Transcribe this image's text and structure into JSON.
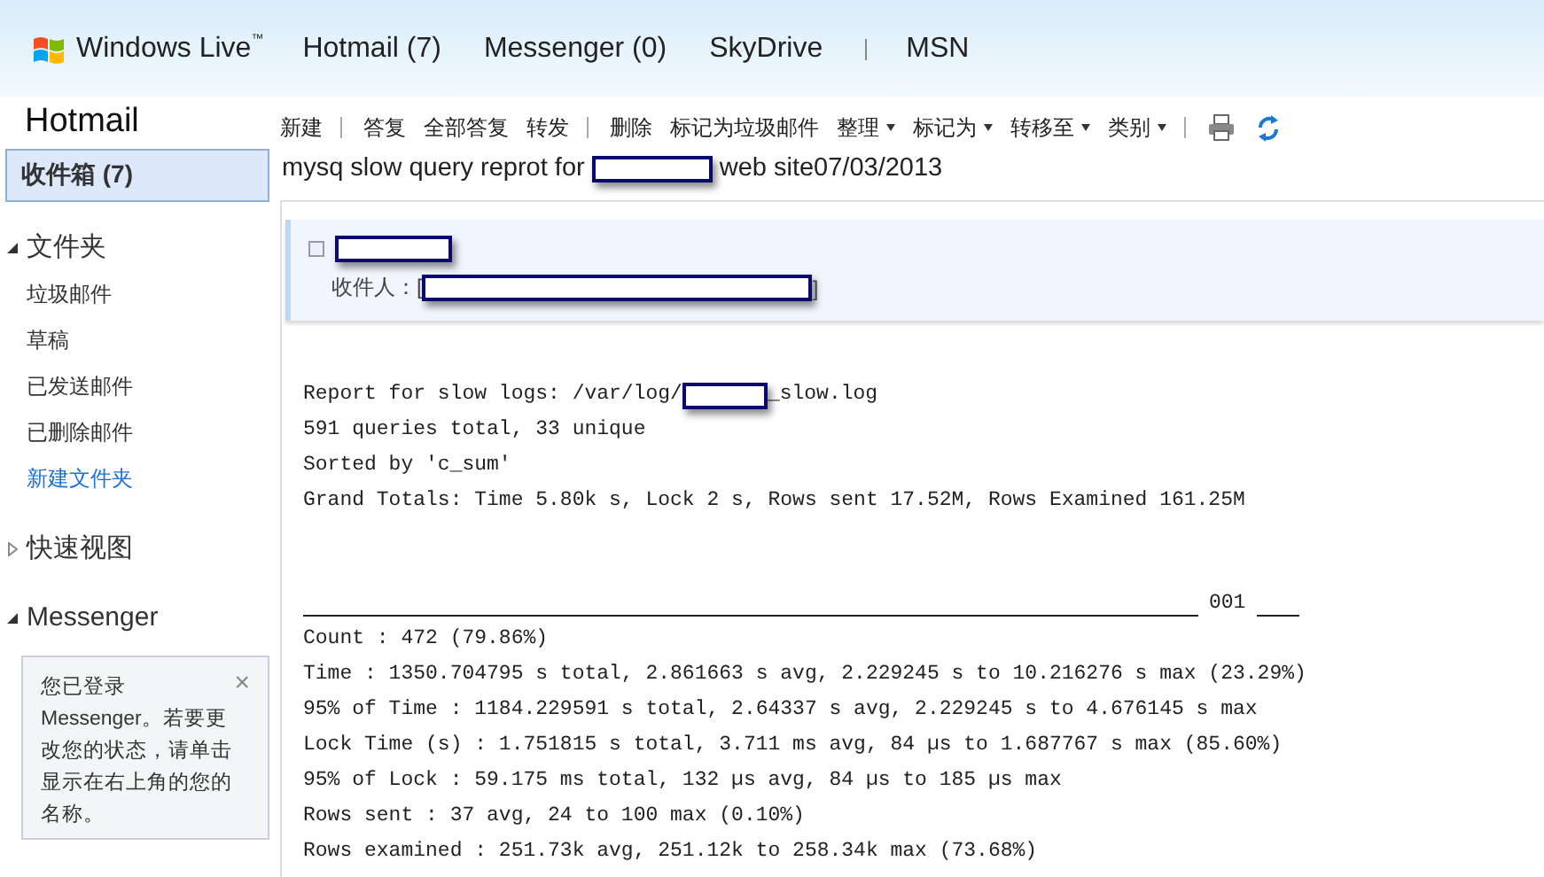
{
  "top_nav": {
    "brand": "Windows Live",
    "trademark": "™",
    "links": [
      {
        "label": "Hotmail (7)",
        "separator_before": false
      },
      {
        "label": "Messenger (0)",
        "separator_before": false
      },
      {
        "label": "SkyDrive",
        "separator_before": false
      },
      {
        "label": "MSN",
        "separator_before": true
      }
    ]
  },
  "sidebar": {
    "title": "Hotmail",
    "inbox": {
      "label": "收件箱 (7)",
      "selected": true
    },
    "sections": [
      {
        "label": "文件夹",
        "expanded": true,
        "items": [
          {
            "label": "垃圾邮件",
            "kind": "folder"
          },
          {
            "label": "草稿",
            "kind": "folder"
          },
          {
            "label": "已发送邮件",
            "kind": "folder"
          },
          {
            "label": "已删除邮件",
            "kind": "folder"
          },
          {
            "label": "新建文件夹",
            "kind": "link"
          }
        ]
      },
      {
        "label": "快速视图",
        "expanded": false
      },
      {
        "label": "Messenger",
        "expanded": true
      }
    ],
    "messenger_notice": {
      "text": "您已登录 Messenger。若要更改您的状态，请单击显示在右上角的您的名称。",
      "close": "×"
    }
  },
  "toolbar": {
    "items": [
      {
        "label": "新建",
        "kind": "plain",
        "separator_before": false
      },
      {
        "label": "答复",
        "kind": "plain",
        "separator_before": true
      },
      {
        "label": "全部答复",
        "kind": "plain",
        "separator_before": false
      },
      {
        "label": "转发",
        "kind": "plain",
        "separator_before": false
      },
      {
        "label": "删除",
        "kind": "plain",
        "separator_before": true
      },
      {
        "label": "标记为垃圾邮件",
        "kind": "plain",
        "separator_before": false
      },
      {
        "label": "整理",
        "kind": "dropdown",
        "separator_before": false
      },
      {
        "label": "标记为",
        "kind": "dropdown",
        "separator_before": false
      },
      {
        "label": "转移至",
        "kind": "dropdown",
        "separator_before": false
      },
      {
        "label": "类别",
        "kind": "dropdown",
        "separator_before": false
      }
    ]
  },
  "message": {
    "subject_before": "mysq slow query reprot for",
    "subject_after": "web site07/03/2013",
    "to_label": "收件人：[",
    "to_close": "]",
    "body_intro": [
      {
        "text": "Report for slow logs: /var/log/",
        "redacted_after": "_slow.log"
      },
      {
        "text": "591 queries total, 33 unique"
      },
      {
        "text": "Sorted by 'c_sum'"
      },
      {
        "text": "Grand Totals: Time 5.80k s, Lock 2 s, Rows sent 17.52M, Rows Examined 161.25M"
      }
    ],
    "section_number": "001",
    "body_lines": [
      "Count : 472 (79.86%)",
      "Time : 1350.704795 s total, 2.861663 s avg, 2.229245 s to 10.216276 s max (23.29%)",
      "95% of Time : 1184.229591 s total, 2.64337 s avg, 2.229245 s to 4.676145 s max",
      "Lock Time (s) : 1.751815 s total, 3.711 ms avg, 84 µs to 1.687767 s max (85.60%)",
      "95% of Lock : 59.175 ms total, 132 µs avg, 84 µs to 185 µs max",
      "Rows sent : 37 avg, 24 to 100 max (0.10%)",
      "Rows examined : 251.73k avg, 251.12k to 258.34k max (73.68%)"
    ]
  }
}
